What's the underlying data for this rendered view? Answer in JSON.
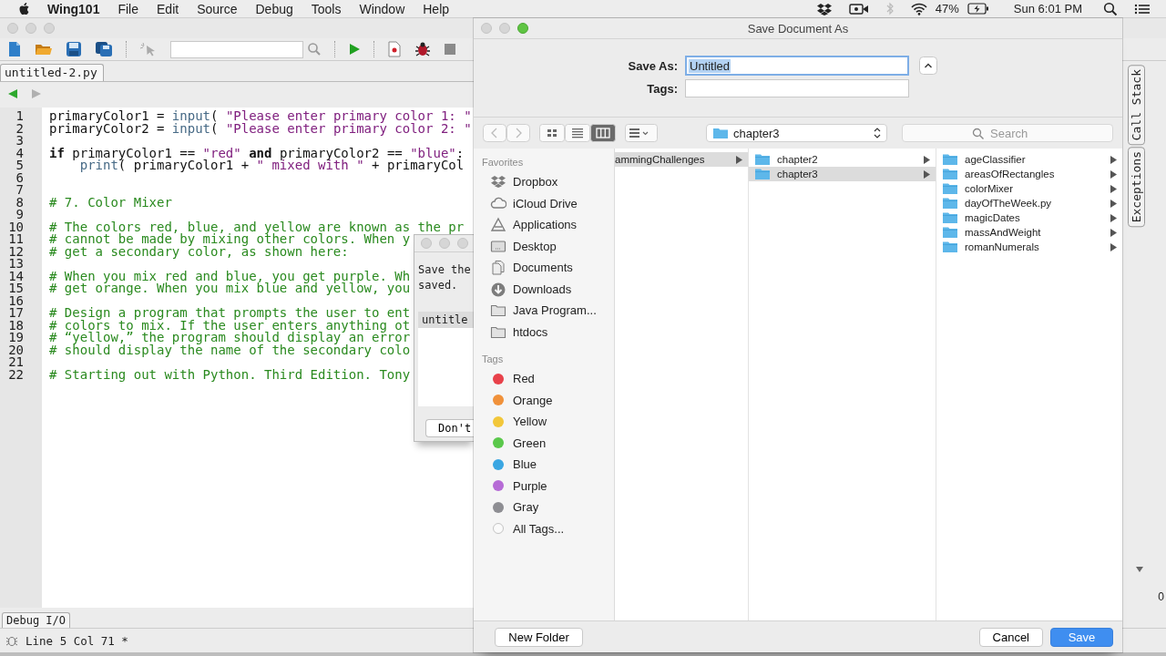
{
  "menu_bar": {
    "app": "Wing101",
    "menus": [
      "File",
      "Edit",
      "Source",
      "Debug",
      "Tools",
      "Window",
      "Help"
    ],
    "battery": "47%",
    "clock": "Sun 6:01 PM"
  },
  "ide": {
    "editor_tab": {
      "label": "untitled-2.py",
      "selected": true
    },
    "code_lines": [
      {
        "number": "1",
        "tokens": [
          {
            "kind": "plain",
            "text": "primaryColor1 = "
          },
          {
            "kind": "builtin",
            "text": "input"
          },
          {
            "kind": "plain",
            "text": "( "
          },
          {
            "kind": "string",
            "text": "\"Please enter primary color 1: \""
          }
        ]
      },
      {
        "number": "2",
        "tokens": [
          {
            "kind": "plain",
            "text": "primaryColor2 = "
          },
          {
            "kind": "builtin",
            "text": "input"
          },
          {
            "kind": "plain",
            "text": "( "
          },
          {
            "kind": "string",
            "text": "\"Please enter primary color 2: \""
          }
        ]
      },
      {
        "number": "3"
      },
      {
        "number": "4",
        "tokens": [
          {
            "kind": "keyword",
            "text": "if"
          },
          {
            "kind": "plain",
            "text": " primaryColor1 == "
          },
          {
            "kind": "string",
            "text": "\"red\""
          },
          {
            "kind": "keyword",
            "text": " and "
          },
          {
            "kind": "plain",
            "text": "primaryColor2 == "
          },
          {
            "kind": "string",
            "text": "\"blue\""
          },
          {
            "kind": "plain",
            "text": ":"
          }
        ]
      },
      {
        "number": "5",
        "tokens": [
          {
            "kind": "builtin",
            "text": "    print"
          },
          {
            "kind": "plain",
            "text": "( primaryColor1 + "
          },
          {
            "kind": "string",
            "text": "\" mixed with \""
          },
          {
            "kind": "plain",
            "text": " + primaryCol"
          }
        ]
      },
      {
        "number": "6"
      },
      {
        "number": "7"
      },
      {
        "number": "8",
        "tokens": [
          {
            "kind": "comment",
            "text": "# 7. Color Mixer"
          }
        ]
      },
      {
        "number": "9"
      },
      {
        "number": "10",
        "tokens": [
          {
            "kind": "comment",
            "text": "# The colors red, blue, and yellow are known as the pr"
          }
        ]
      },
      {
        "number": "11",
        "tokens": [
          {
            "kind": "comment",
            "text": "# cannot be made by mixing other colors. When y"
          }
        ]
      },
      {
        "number": "12",
        "tokens": [
          {
            "kind": "comment",
            "text": "# get a secondary color, as shown here:"
          }
        ]
      },
      {
        "number": "13"
      },
      {
        "number": "14",
        "tokens": [
          {
            "kind": "comment",
            "text": "# When you mix red and blue, you get purple. Wh"
          }
        ]
      },
      {
        "number": "15",
        "tokens": [
          {
            "kind": "comment",
            "text": "# get orange. When you mix blue and yellow, you"
          }
        ]
      },
      {
        "number": "16"
      },
      {
        "number": "17",
        "tokens": [
          {
            "kind": "comment",
            "text": "# Design a program that prompts the user to ent"
          }
        ]
      },
      {
        "number": "18",
        "tokens": [
          {
            "kind": "comment",
            "text": "# colors to mix. If the user enters anything ot"
          }
        ]
      },
      {
        "number": "19",
        "tokens": [
          {
            "kind": "comment",
            "text": "# “yellow,” the program should display an error"
          }
        ]
      },
      {
        "number": "20",
        "tokens": [
          {
            "kind": "comment",
            "text": "# should display the name of the secondary colo"
          }
        ]
      },
      {
        "number": "21"
      },
      {
        "number": "22",
        "tokens": [
          {
            "kind": "comment",
            "text": "# Starting out with Python. Third Edition. Tony"
          }
        ]
      }
    ],
    "side_tabs": [
      "Call Stack",
      "Exceptions"
    ],
    "corner_text": "0",
    "bottom_tab": "Debug I/O",
    "status": "Line 5 Col 71 *"
  },
  "unsaved_dialog": {
    "message_lines": [
      "Save the",
      "saved."
    ],
    "file": "untitle",
    "button": "Don't"
  },
  "save_dialog": {
    "title": "Save Document As",
    "save_as": {
      "label": "Save As:",
      "value": "Untitled",
      "value_selected": true
    },
    "tags": {
      "label": "Tags:"
    },
    "views": [
      {
        "kind": "icon",
        "selected": false
      },
      {
        "kind": "list",
        "selected": false
      },
      {
        "kind": "column",
        "selected": true
      },
      {
        "kind": "gallery",
        "selected": false
      }
    ],
    "location": "chapter3",
    "search": {
      "placeholder": "Search"
    },
    "sidebar": [
      {
        "title": "Favorites",
        "items": [
          {
            "label": "Dropbox",
            "kind": "dropbox"
          },
          {
            "label": "iCloud Drive",
            "kind": "cloud"
          },
          {
            "label": "Applications",
            "kind": "apps"
          },
          {
            "label": "Desktop",
            "kind": "desktop"
          },
          {
            "label": "Documents",
            "kind": "documents"
          },
          {
            "label": "Downloads",
            "kind": "downloads"
          },
          {
            "label": "Java Program...",
            "kind": "folder"
          },
          {
            "label": "htdocs",
            "kind": "folder"
          }
        ]
      },
      {
        "title": "Tags",
        "items": [
          {
            "label": "Red",
            "kind": "tag",
            "color": "#e8414a"
          },
          {
            "label": "Orange",
            "kind": "tag",
            "color": "#f0913a"
          },
          {
            "label": "Yellow",
            "kind": "tag",
            "color": "#f2c73a"
          },
          {
            "label": "Green",
            "kind": "tag",
            "color": "#5ac84b"
          },
          {
            "label": "Blue",
            "kind": "tag",
            "color": "#3aa6e2"
          },
          {
            "label": "Purple",
            "kind": "tag",
            "color": "#b66bd6"
          },
          {
            "label": "Gray",
            "kind": "tag",
            "color": "#8e8e93"
          },
          {
            "label": "All Tags...",
            "kind": "all"
          }
        ]
      }
    ],
    "columns": [
      [
        {
          "name": "ammingChallenges",
          "kind": "text",
          "selected": true
        }
      ],
      [
        {
          "name": "chapter2",
          "kind": "folder",
          "selected": false
        },
        {
          "name": "chapter3",
          "kind": "folder",
          "selected": true
        }
      ],
      [
        {
          "name": "ageClassifier",
          "kind": "folder",
          "selected": false
        },
        {
          "name": "areasOfRectangles",
          "kind": "folder",
          "selected": false
        },
        {
          "name": "colorMixer",
          "kind": "folder",
          "selected": false
        },
        {
          "name": "dayOfTheWeek.py",
          "kind": "folder",
          "selected": false
        },
        {
          "name": "magicDates",
          "kind": "folder",
          "selected": false
        },
        {
          "name": "massAndWeight",
          "kind": "folder",
          "selected": false
        },
        {
          "name": "romanNumerals",
          "kind": "folder",
          "selected": false
        }
      ]
    ],
    "buttons": {
      "new_folder": "New Folder",
      "cancel": "Cancel",
      "save": "Save"
    }
  }
}
